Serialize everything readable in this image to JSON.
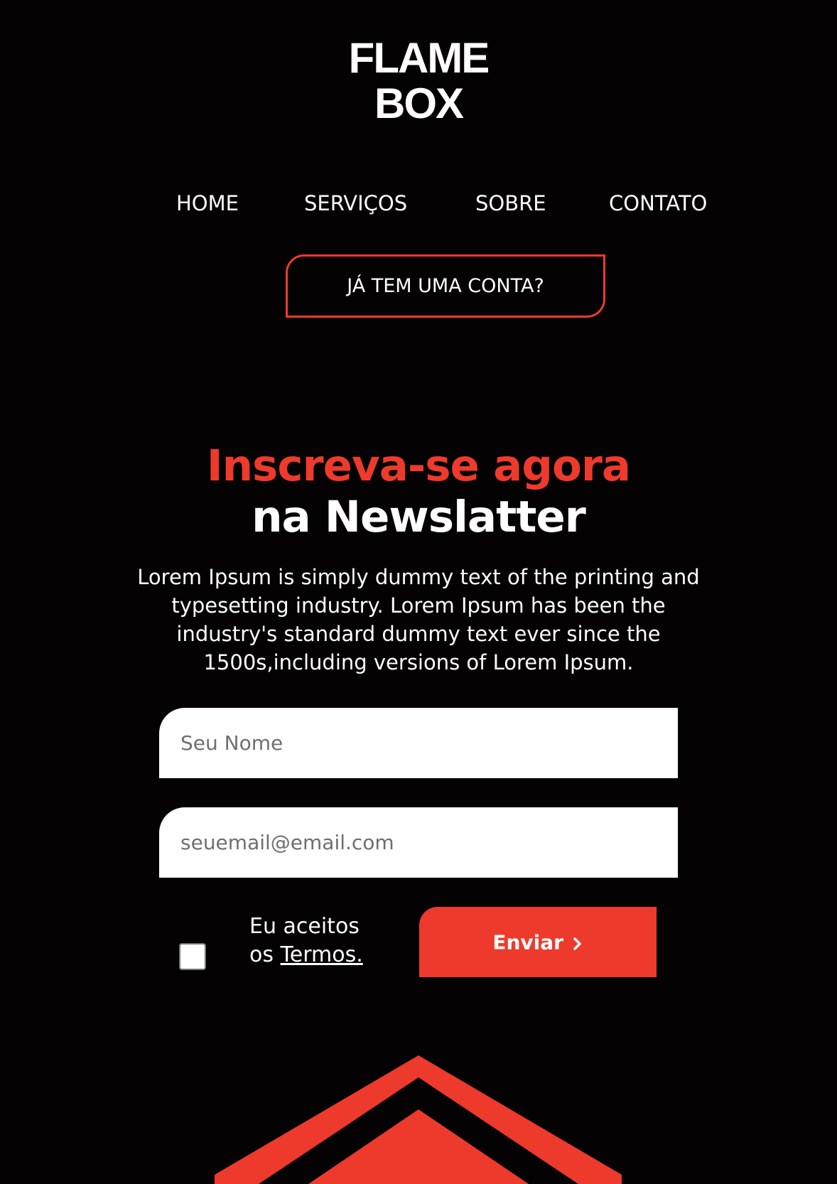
{
  "brand": {
    "line1": "FLAME",
    "line2": "BOX"
  },
  "nav": {
    "items": [
      {
        "label": "HOME"
      },
      {
        "label": "SERVIÇOS"
      },
      {
        "label": "SOBRE"
      },
      {
        "label": "CONTATO"
      }
    ]
  },
  "account": {
    "label": "JÁ TEM UMA CONTA?"
  },
  "newsletter": {
    "title_accent": "Inscreva-se agora",
    "title_rest": "na Newslatter",
    "description": "Lorem Ipsum is simply dummy text of the printing and typesetting industry. Lorem Ipsum has been the industry's standard dummy text ever since the 1500s,including versions of Lorem Ipsum.",
    "name_placeholder": "Seu Nome",
    "name_value": "",
    "email_placeholder": "seuemail@email.com",
    "email_value": "",
    "terms_line1": "Eu aceitos",
    "terms_prefix": "os",
    "terms_link": "Termos.",
    "terms_checked": false,
    "submit_label": "Enviar",
    "submit_icon": "chevron-right-icon"
  },
  "colors": {
    "background": "#050203",
    "accent": "#ee3a2c",
    "text": "#ffffff"
  }
}
